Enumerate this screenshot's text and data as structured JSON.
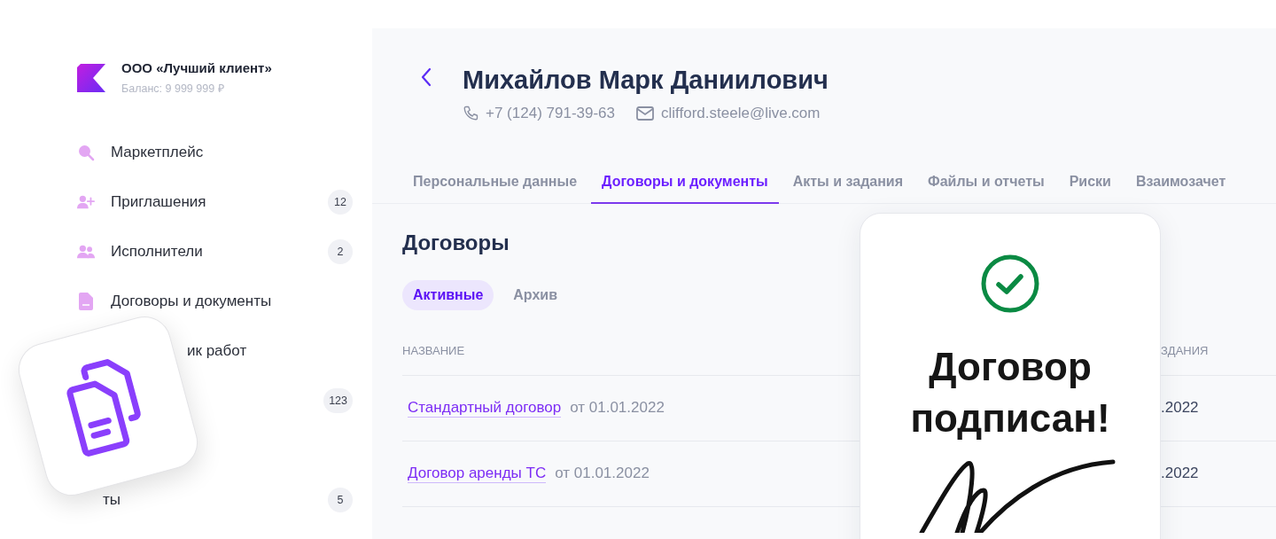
{
  "company": {
    "name": "ООО «Лучший клиент»",
    "balance": "Баланс: 9 999 999 ₽"
  },
  "sidebar": {
    "items": [
      {
        "kind": "full",
        "label": "Маркетплейс"
      },
      {
        "kind": "full",
        "label": "Приглашения",
        "badge": "12"
      },
      {
        "kind": "full",
        "label": "Исполнители",
        "badge": "2"
      },
      {
        "kind": "full",
        "label": "Договоры и документы"
      },
      {
        "kind": "covered",
        "label": "ик работ"
      },
      {
        "kind": "covered",
        "badge": "123"
      },
      {
        "kind": "covered",
        "label": "ты",
        "badge": "5"
      }
    ]
  },
  "person": {
    "name": "Михайлов Марк Даниилович",
    "phone": "+7 (124) 791-39-63",
    "email": "clifford.steele@live.com"
  },
  "tabs": [
    {
      "label": "Персональные данные",
      "selected": false
    },
    {
      "label": "Договоры и документы",
      "selected": true
    },
    {
      "label": "Акты и задания",
      "selected": false
    },
    {
      "label": "Файлы и отчеты",
      "selected": false
    },
    {
      "label": "Риски",
      "selected": false
    },
    {
      "label": "Взаимозачет",
      "selected": false
    }
  ],
  "section": {
    "title": "Договоры",
    "filters": [
      {
        "label": "Активные",
        "selected": true
      },
      {
        "label": "Архив",
        "selected": false
      }
    ]
  },
  "table": {
    "columns": [
      "НАЗВАНИЕ",
      "ЗДАНИЯ"
    ],
    "rows": [
      {
        "name": "Стандартный договор",
        "date": "от 01.01.2022",
        "column_2": ".2022"
      },
      {
        "name": "Договор аренды ТС",
        "date": "от 01.01.2022",
        "column_2": ".2022"
      }
    ]
  },
  "popup": {
    "message": "Договор подписан!"
  }
}
